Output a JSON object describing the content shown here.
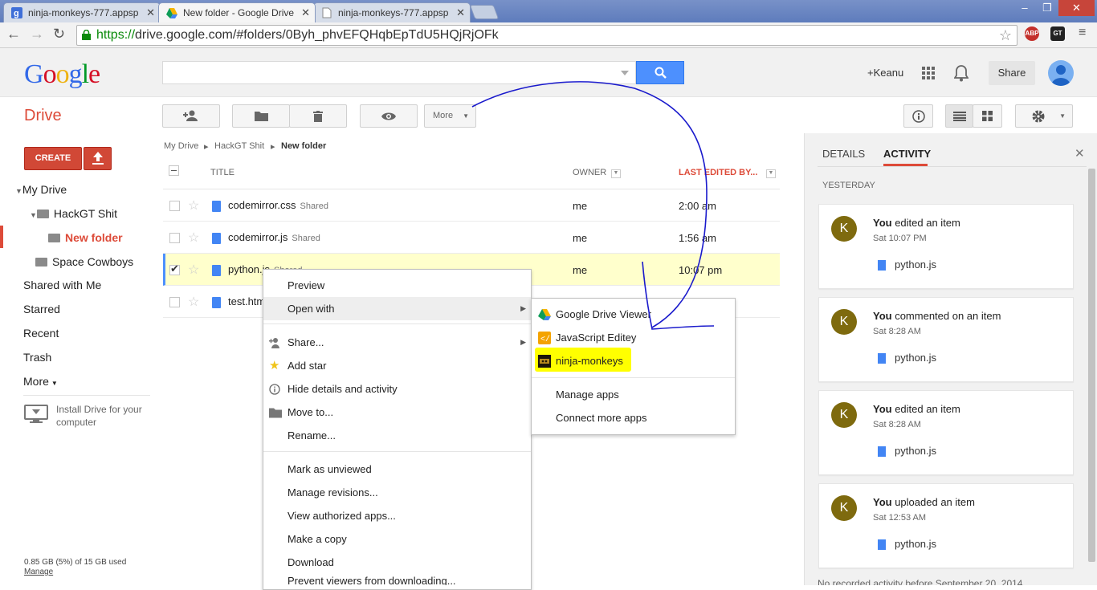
{
  "browser": {
    "tabs": [
      {
        "title": "ninja-monkeys-777.appsp",
        "close": "✕"
      },
      {
        "title": "New folder - Google Drive",
        "close": "✕"
      },
      {
        "title": "ninja-monkeys-777.appsp",
        "close": "✕"
      }
    ],
    "url_scheme": "https://",
    "url_rest": "drive.google.com/#folders/0Byh_phvEFQHqbEpTdU5HQjRjOFk",
    "ext_abp": "ABP",
    "ext_gt": "GT"
  },
  "header": {
    "logo": "Google",
    "search_placeholder": "",
    "user": "+Keanu",
    "share": "Share"
  },
  "toolbar": {
    "app_title": "Drive",
    "more": "More"
  },
  "sidebar": {
    "create": "CREATE",
    "items": [
      "My Drive",
      "HackGT Shit",
      "New folder",
      "Space Cowboys",
      "Shared with Me",
      "Starred",
      "Recent",
      "Trash",
      "More"
    ],
    "install": "Install Drive for your computer",
    "storage": "0.85 GB (5%) of 15 GB used",
    "manage": "Manage"
  },
  "breadcrumb": [
    "My Drive",
    "HackGT Shit",
    "New folder"
  ],
  "list": {
    "columns": {
      "title": "TITLE",
      "owner": "OWNER",
      "edited": "LAST EDITED BY..."
    },
    "rows": [
      {
        "name": "codemirror.css",
        "tag": "Shared",
        "owner": "me",
        "edited": "2:00 am"
      },
      {
        "name": "codemirror.js",
        "tag": "Shared",
        "owner": "me",
        "edited": "1:56 am"
      },
      {
        "name": "python.js",
        "tag": "Shared",
        "owner": "me",
        "edited": "10:07 pm"
      },
      {
        "name": "test.html",
        "tag": "",
        "owner": "",
        "edited": ""
      }
    ]
  },
  "context_menu": {
    "items": [
      "Preview",
      "Open with",
      "Share...",
      "Add star",
      "Hide details and activity",
      "Move to...",
      "Rename...",
      "Mark as unviewed",
      "Manage revisions...",
      "View authorized apps...",
      "Make a copy",
      "Download",
      "Prevent viewers from downloading..."
    ]
  },
  "open_with": {
    "items": [
      "Google Drive Viewer",
      "JavaScript Editey",
      "ninja-monkeys",
      "Manage apps",
      "Connect more apps"
    ],
    "highlight_color": "#ffff00"
  },
  "panel": {
    "tabs": [
      "DETAILS",
      "ACTIVITY"
    ],
    "close": "✕",
    "section": "YESTERDAY",
    "activities": [
      {
        "avatar": "K",
        "who": "You",
        "what": " edited an item",
        "time": "Sat 10:07 PM",
        "file": "python.js"
      },
      {
        "avatar": "K",
        "who": "You",
        "what": " commented on an item",
        "time": "Sat 8:28 AM",
        "file": "python.js"
      },
      {
        "avatar": "K",
        "who": "You",
        "what": " edited an item",
        "time": "Sat 8:28 AM",
        "file": "python.js"
      },
      {
        "avatar": "K",
        "who": "You",
        "what": " uploaded an item",
        "time": "Sat 12:53 AM",
        "file": "python.js"
      }
    ],
    "footer": "No recorded activity before September 20, 2014"
  },
  "colors": {
    "accent_red": "#dd4b39",
    "blue": "#4d90fe",
    "annotation": "#1a1acc"
  }
}
